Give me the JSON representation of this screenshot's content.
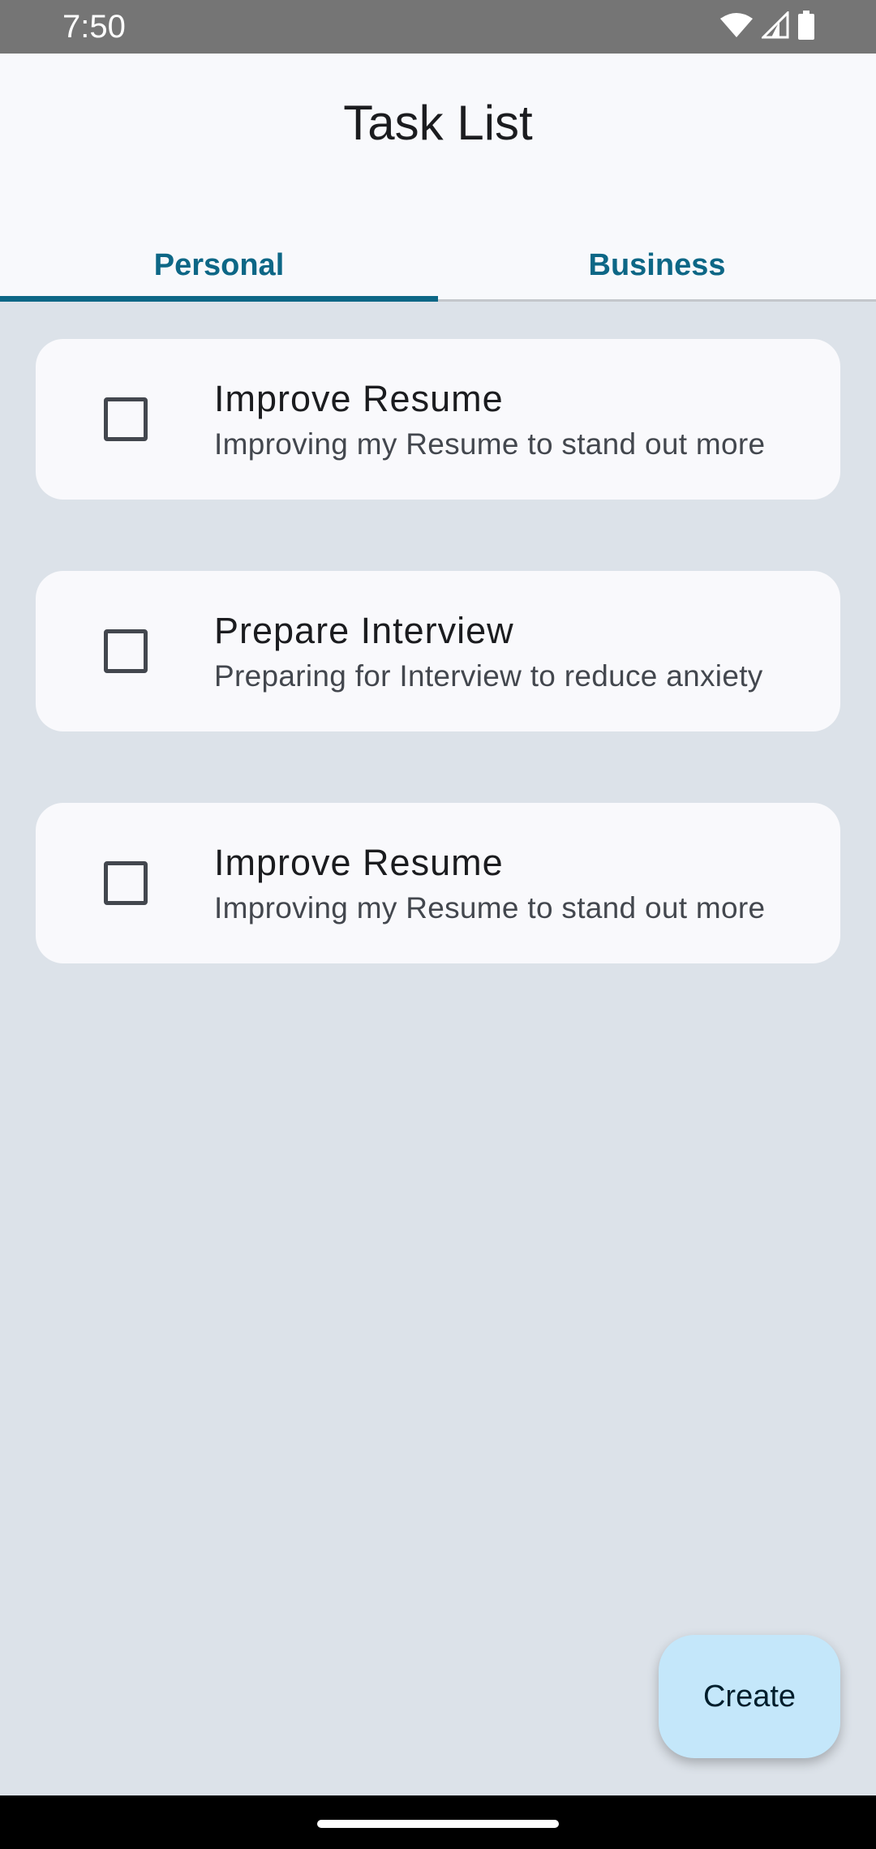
{
  "status_bar": {
    "time": "7:50",
    "icons": [
      "wifi-icon",
      "cellular-signal-icon",
      "battery-icon"
    ]
  },
  "app_bar": {
    "title": "Task List"
  },
  "tabs": [
    {
      "label": "Personal",
      "active": true
    },
    {
      "label": "Business",
      "active": false
    }
  ],
  "tasks": [
    {
      "title": "Improve Resume",
      "description": "Improving my Resume to stand out more",
      "checked": false
    },
    {
      "title": "Prepare Interview",
      "description": "Preparing for Interview to reduce anxiety",
      "checked": false
    },
    {
      "title": "Improve Resume",
      "description": "Improving my Resume to stand out more",
      "checked": false
    }
  ],
  "fab": {
    "label": "Create"
  },
  "colors": {
    "accent": "#0d6786",
    "background": "#dce2e9",
    "surface": "#f9f9fc",
    "fab": "#c4e7fa",
    "status_bar": "#757575"
  }
}
